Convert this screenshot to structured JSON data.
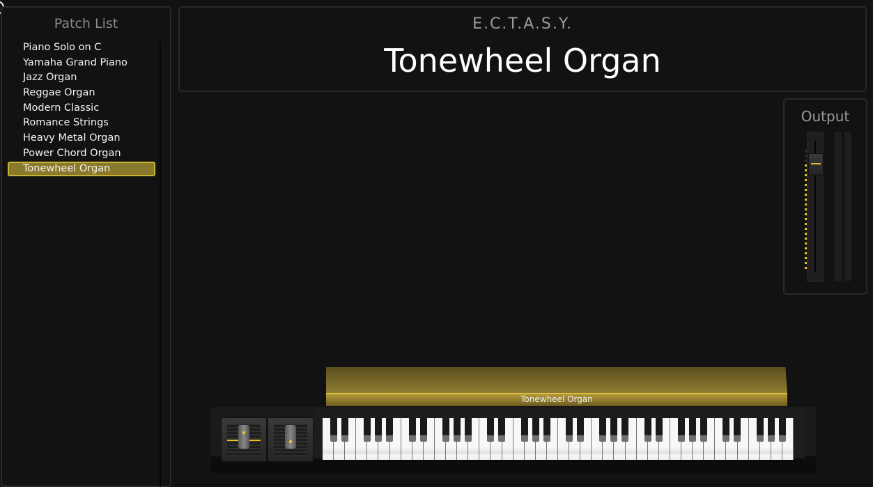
{
  "patch_list": {
    "title": "Patch List",
    "items": [
      {
        "label": "Piano Solo on C",
        "selected": false
      },
      {
        "label": "Yamaha Grand Piano",
        "selected": false
      },
      {
        "label": "Jazz Organ",
        "selected": false
      },
      {
        "label": "Reggae Organ",
        "selected": false
      },
      {
        "label": "Modern Classic",
        "selected": false
      },
      {
        "label": "Romance Strings",
        "selected": false
      },
      {
        "label": "Heavy Metal Organ",
        "selected": false
      },
      {
        "label": "Power Chord Organ",
        "selected": false
      },
      {
        "label": "Tonewheel Organ",
        "selected": true
      }
    ]
  },
  "header": {
    "brand": "E.C.T.A.S.Y.",
    "patch_name": "Tonewheel Organ"
  },
  "output": {
    "title": "Output",
    "fader_level_fraction": 0.88,
    "meter_lit_dots": 22,
    "meter_total_dots": 25
  },
  "instrument": {
    "lid_label": "Tonewheel Organ",
    "keyboard": {
      "white_keys": 42,
      "start_note": "C",
      "end_note": "B"
    },
    "pitch_wheel": {
      "icon": "pitch-wheel-icon"
    },
    "mod_wheel": {
      "icon": "mod-wheel-icon"
    }
  },
  "colors": {
    "accent": "#c9b437",
    "selection_bg": "#8a7a2c",
    "meter_on": "#f5c21a",
    "background": "#121212"
  }
}
